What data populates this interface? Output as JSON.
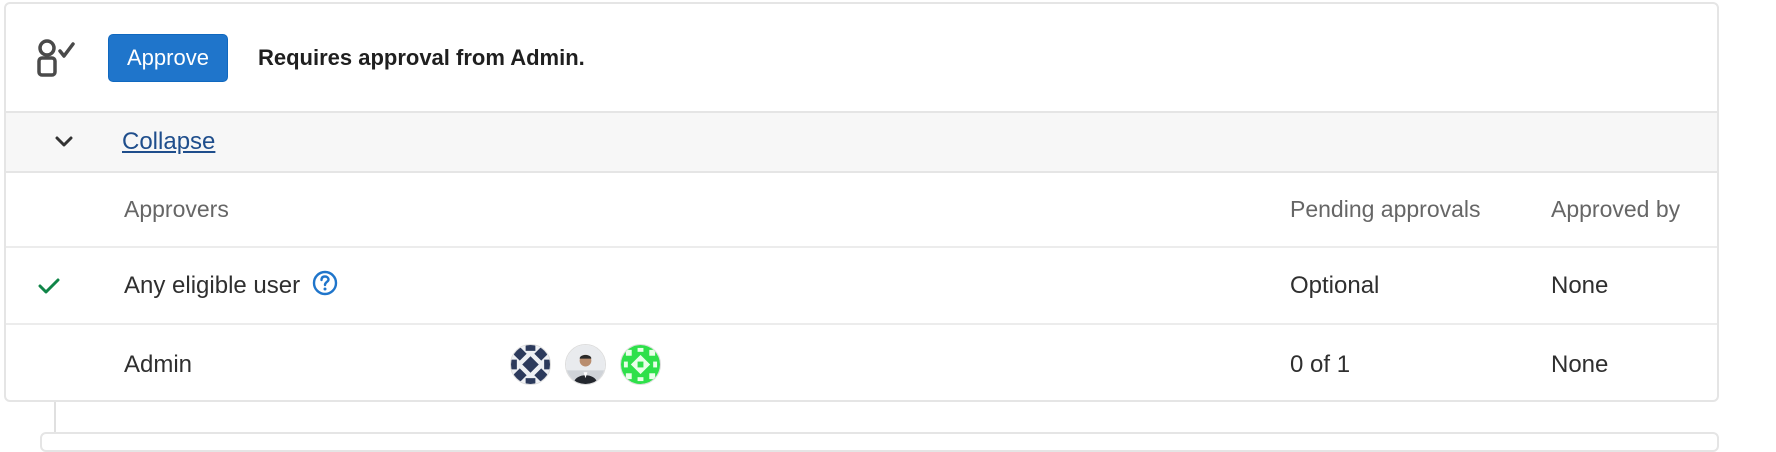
{
  "header": {
    "status_icon": "approval-icon",
    "approve_label": "Approve",
    "summary": "Requires approval from Admin."
  },
  "collapse": {
    "icon": "chevron-down-icon",
    "label": "Collapse"
  },
  "table": {
    "columns": {
      "approvers": "Approvers",
      "pending": "Pending approvals",
      "approved_by": "Approved by"
    },
    "rows": [
      {
        "status_icon": "check-icon",
        "name": "Any eligible user",
        "help_icon": "question-circle-icon",
        "pending": "Optional",
        "approved_by": "None"
      },
      {
        "name": "Admin",
        "avatars": [
          "avatar-pattern-navy",
          "avatar-photo-person",
          "avatar-pattern-green"
        ],
        "pending": "0 of 1",
        "approved_by": "None"
      }
    ]
  },
  "colors": {
    "primary": "#1f75cb",
    "success": "#108548",
    "link": "#1f4e8c"
  }
}
